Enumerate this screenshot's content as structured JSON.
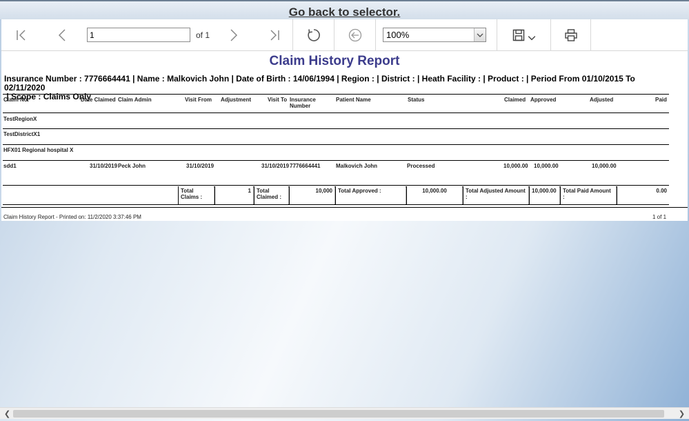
{
  "topbar": {
    "back_link": "Go back to selector."
  },
  "toolbar": {
    "page_value": "1",
    "of_label": "of 1",
    "zoom_value": "100%"
  },
  "report": {
    "title": "Claim History Report",
    "params_line1": "Insurance Number : 7776664441 | Name : Malkovich John | Date of Birth : 14/06/1994 | Region : | District : | Heath Facility : | Product : | Period  From 01/10/2015 To 02/11/2020",
    "params_line2": " | Scope : Claims Only",
    "columns": {
      "claim_no": "Claim No.",
      "date_claimed": "Date Claimed",
      "claim_admin": "Claim Admin",
      "visit_from": "Visit From",
      "adjustment": "Adjustment",
      "visit_to": "Visit To",
      "insurance_number": "Insurance Number",
      "patient_name": "Patient Name",
      "status": "Status",
      "claimed": "Claimed",
      "approved": "Approved",
      "adjusted": "Adjusted",
      "paid": "Paid"
    },
    "groups": {
      "region": "TestRegionX",
      "district": "TestDistrictX1",
      "facility": "HFX01 Regional hospital X"
    },
    "row": {
      "claim_no": "sdd1",
      "date_claimed": "31/10/2019",
      "claim_admin": "Peck John",
      "visit_from": "31/10/2019",
      "visit_to": "31/10/2019",
      "insurance_number": "7776664441",
      "patient_name": "Malkovich John",
      "status": "Processed",
      "claimed": "10,000.00",
      "approved": "10,000.00",
      "adjusted": "10,000.00"
    },
    "totals": {
      "total_claims_label": "Total Claims :",
      "total_claims_value": "1",
      "total_claimed_label": "Total Claimed :",
      "total_claimed_value": "10,000",
      "total_approved_label": "Total Approved :",
      "total_approved_value": "10,000.00",
      "total_adjusted_label": "Total Adjusted Amount :",
      "total_adjusted_value": "10,000.00",
      "total_paid_label": "Total Paid Amount :",
      "total_paid_value": "0.00"
    },
    "footer": {
      "printed_on": "Claim History Report - Printed on: 11/2/2020 3:37:46 PM",
      "page_count": "1 of 1"
    }
  },
  "icons": {
    "first": "first-page-icon",
    "prev": "previous-page-icon",
    "next": "next-page-icon",
    "last": "last-page-icon",
    "refresh": "refresh-icon",
    "back": "back-icon",
    "save": "save-icon",
    "print": "print-icon"
  }
}
